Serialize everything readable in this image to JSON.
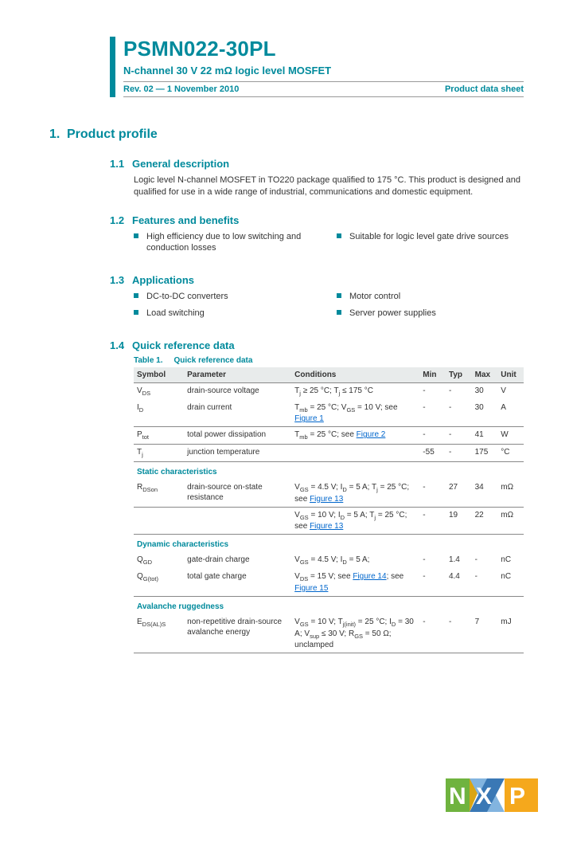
{
  "header": {
    "part": "PSMN022-30PL",
    "subtitle": "N-channel 30 V 22 mΩ logic level MOSFET",
    "rev": "Rev. 02 — 1 November 2010",
    "doctype": "Product data sheet"
  },
  "section1": {
    "num": "1.",
    "title": "Product profile",
    "s11": {
      "num": "1.1",
      "title": "General description",
      "text": "Logic level N-channel MOSFET in TO220 package qualified to 175 °C. This product is designed and qualified for use in a wide range of industrial, communications and domestic equipment."
    },
    "s12": {
      "num": "1.2",
      "title": "Features and benefits",
      "left": [
        "High efficiency due to low switching and conduction losses"
      ],
      "right": [
        "Suitable for logic level gate drive sources"
      ]
    },
    "s13": {
      "num": "1.3",
      "title": "Applications",
      "left": [
        "DC-to-DC converters",
        "Load switching"
      ],
      "right": [
        "Motor control",
        "Server power supplies"
      ]
    },
    "s14": {
      "num": "1.4",
      "title": "Quick reference data",
      "tableCaptionNum": "Table 1.",
      "tableCaption": "Quick reference data",
      "headers": [
        "Symbol",
        "Parameter",
        "Conditions",
        "Min",
        "Typ",
        "Max",
        "Unit"
      ],
      "rows": [
        {
          "sym": "V<sub>DS</sub>",
          "param": "drain-source voltage",
          "cond": "T<sub>j</sub> ≥ 25 °C; T<sub>j</sub> ≤ 175 °C",
          "min": "-",
          "typ": "-",
          "max": "30",
          "unit": "V",
          "sep": false
        },
        {
          "sym": "I<sub>D</sub>",
          "param": "drain current",
          "cond": "T<sub>mb</sub> = 25 °C; V<sub>GS</sub> = 10 V; see <span class='figlink'>Figure 1</span>",
          "min": "-",
          "typ": "-",
          "max": "30",
          "unit": "A",
          "sep": true
        },
        {
          "sym": "P<sub>tot</sub>",
          "param": "total power dissipation",
          "cond": "T<sub>mb</sub> = 25 °C; see <span class='figlink'>Figure 2</span>",
          "min": "-",
          "typ": "-",
          "max": "41",
          "unit": "W",
          "sep": true
        },
        {
          "sym": "T<sub>j</sub>",
          "param": "junction temperature",
          "cond": "",
          "min": "-55",
          "typ": "-",
          "max": "175",
          "unit": "°C",
          "sep": true
        }
      ],
      "static": {
        "label": "Static characteristics",
        "rows": [
          {
            "sym": "R<sub>DSon</sub>",
            "param": "drain-source on-state resistance",
            "cond": "V<sub>GS</sub> = 4.5 V; I<sub>D</sub> = 5 A; T<sub>j</sub> = 25 °C; see <span class='figlink'>Figure 13</span>",
            "min": "-",
            "typ": "27",
            "max": "34",
            "unit": "mΩ",
            "sep": true
          },
          {
            "sym": "",
            "param": "",
            "cond": "V<sub>GS</sub> = 10 V; I<sub>D</sub> = 5 A; T<sub>j</sub> = 25 °C; see <span class='figlink'>Figure 13</span>",
            "min": "-",
            "typ": "19",
            "max": "22",
            "unit": "mΩ",
            "sep": true
          }
        ]
      },
      "dynamic": {
        "label": "Dynamic characteristics",
        "rows": [
          {
            "sym": "Q<sub>GD</sub>",
            "param": "gate-drain charge",
            "cond": "V<sub>GS</sub> = 4.5 V; I<sub>D</sub> = 5 A;",
            "min": "-",
            "typ": "1.4",
            "max": "-",
            "unit": "nC",
            "sep": false
          },
          {
            "sym": "Q<sub>G(tot)</sub>",
            "param": "total gate charge",
            "cond": "V<sub>DS</sub> = 15 V; see <span class='figlink'>Figure 14</span>; see <span class='figlink'>Figure 15</span>",
            "min": "-",
            "typ": "4.4",
            "max": "-",
            "unit": "nC",
            "sep": true
          }
        ]
      },
      "avalanche": {
        "label": "Avalanche ruggedness",
        "rows": [
          {
            "sym": "E<sub>DS(AL)S</sub>",
            "param": "non-repetitive drain-source avalanche energy",
            "cond": "V<sub>GS</sub> = 10 V; T<sub>j(init)</sub> = 25 °C; I<sub>D</sub> = 30 A; V<sub>sup</sub> ≤ 30 V; R<sub>GS</sub> = 50 Ω; unclamped",
            "min": "-",
            "typ": "-",
            "max": "7",
            "unit": "mJ",
            "sep": true
          }
        ]
      }
    }
  }
}
